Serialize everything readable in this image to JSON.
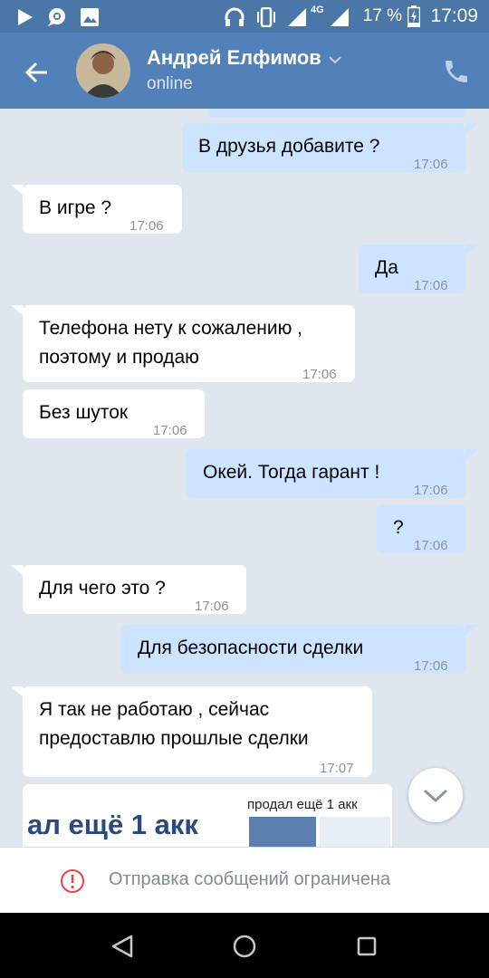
{
  "status_bar": {
    "network": "4G",
    "battery": "17 %",
    "time": "17:09",
    "icons": [
      "play-icon",
      "chat-notification-icon",
      "image-icon",
      "headphones-icon",
      "vibrate-icon",
      "signal-icon",
      "charging-battery-icon"
    ]
  },
  "header": {
    "contact_name": "Андрей Елфимов",
    "status": "online",
    "icons": [
      "back-arrow-icon",
      "chevron-down-icon",
      "phone-icon"
    ]
  },
  "messages": [
    {
      "direction": "out",
      "text": "В друзья добавите ?",
      "time": "17:06"
    },
    {
      "direction": "in",
      "text": "В игре ?",
      "time": "17:06"
    },
    {
      "direction": "out",
      "text": "Да",
      "time": "17:06"
    },
    {
      "direction": "in",
      "lines": [
        "Телефона нету к сожалению ,",
        "поэтому и продаю"
      ],
      "time": "17:06"
    },
    {
      "direction": "in",
      "text": "Без шуток",
      "time": "17:06"
    },
    {
      "direction": "out",
      "text": "Окей. Тогда гарант !",
      "time": "17:06"
    },
    {
      "direction": "out",
      "text": "?",
      "time": "17:06"
    },
    {
      "direction": "in",
      "text": "Для чего это ?",
      "time": "17:06"
    },
    {
      "direction": "out",
      "text": "Для безопасности сделки",
      "time": "17:06"
    },
    {
      "direction": "in",
      "lines": [
        "Я так не работаю , сейчас",
        "предоставлю прошлые сделки"
      ],
      "time": "17:07"
    }
  ],
  "attachment": {
    "text_large": "ал ещё 1 акк",
    "text_small": "продал ещё 1 акк"
  },
  "footer": {
    "restricted_text": "Отправка сообщений ограничена"
  },
  "colors": {
    "header": "#5181b8",
    "background": "#dfe6ee",
    "outgoing_bubble": "#cce4ff",
    "incoming_bubble": "#ffffff",
    "warning": "#e64646"
  }
}
